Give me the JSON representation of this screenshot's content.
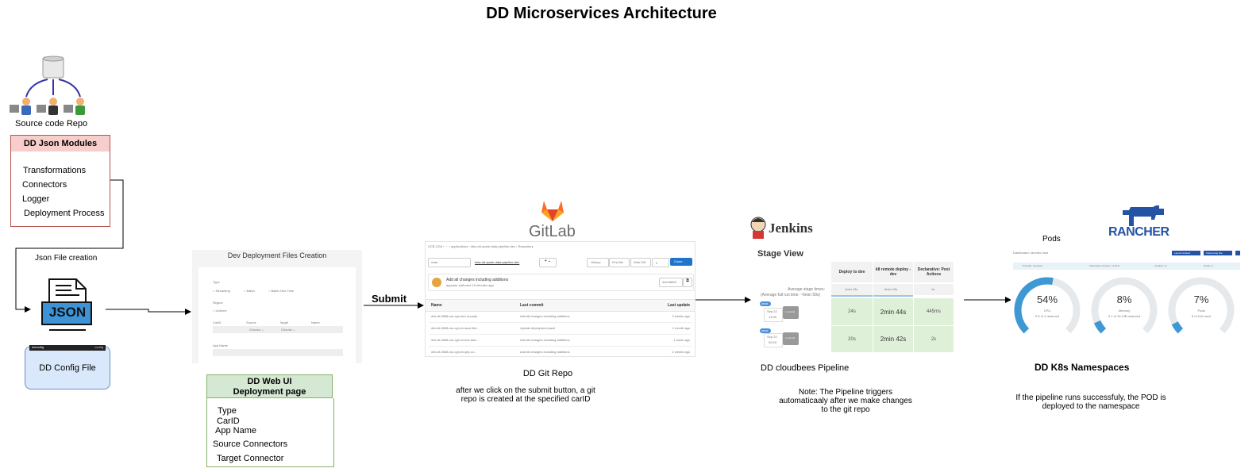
{
  "title": "DD Microservices Architecture",
  "source_repo": {
    "label": "Source code Repo",
    "icon_text": "Source Code Repository"
  },
  "json_modules": {
    "header": "DD Json Modules",
    "items": [
      "Transformations",
      "Connectors",
      "Logger",
      "Deployment Process"
    ]
  },
  "json_file_creation_label": "Json File creation",
  "json_icon_text": "JSON",
  "config_file": {
    "label": "DD Config File",
    "bar_left": "ddconfig",
    "bar_right": "config"
  },
  "dev_deploy_page": {
    "title": "Dev Deployment Files Creation",
    "type_label": "Type",
    "type_options": [
      "Streaming",
      "Batch",
      "Batch One Time"
    ],
    "region_label": "Region",
    "region_option": "Uniform",
    "columns": [
      "CarID",
      "Source",
      "Target",
      "Name"
    ],
    "choose_1": "Choose",
    "choose_2": "Choose",
    "app_name_label": "App Name"
  },
  "web_ui": {
    "header_line1": "DD Web UI",
    "header_line2": "Deployment page",
    "items": [
      "Type",
      "CarID",
      "App Name",
      "Source Connectors",
      "Target Connector"
    ]
  },
  "submit_label": "Submit",
  "gitlab": {
    "logo_text": "GitLab",
    "breadcrumb": "UCB-CDA  ›  ···  ›  applications  ›  ddw-dd-spark-data-pipeline-dev  ›  Repository",
    "branch": "main",
    "repo_path": "ddw-dd-spark-data-pipeline-dev",
    "buttons": [
      "History",
      "Find file",
      "Web IDE",
      "⤓",
      "Clone"
    ],
    "commit_title": "Add all changes including additions",
    "commit_meta": "appuser authored 15 minutes ago",
    "commit_hash": "34e18800",
    "table_headers": [
      "Name",
      "Last commit",
      "Last update"
    ],
    "rows": [
      {
        "name": "ddx-bt-0658-csv-rgh-dev-vt-party",
        "commit": "Add all changes including additions",
        "update": "3 weeks ago"
      },
      {
        "name": "ddx-bt-0658-csv-rgh-ed-acct-8xt...",
        "commit": "Update deployment.yaml",
        "update": "1 month ago"
      },
      {
        "name": "ddx-bt-0658-csv-rgh-ed-ent-add...",
        "commit": "Add all changes including additions",
        "update": "1 week ago"
      },
      {
        "name": "ddx-bt-0658-csv-rgh-ed-pty-co...",
        "commit": "Add all changes including additions",
        "update": "2 weeks ago"
      }
    ],
    "caption": "DD Git Repo",
    "note_line1": "after we click on the submit button, a git",
    "note_line2": "repo is created at the specified carID"
  },
  "jenkins": {
    "logo_text": "Jenkins",
    "stage_view": "Stage View",
    "stages": [
      "Deploy to dev",
      "k8 remote deploy - dev",
      "Declarative: Post Actions"
    ],
    "avg_label1": "Average stage times:",
    "avg_label2": "(Average full run time: ~6min 59s)",
    "avg_times": [
      "1min 13s",
      "5min 15s",
      "1s"
    ],
    "runs": [
      {
        "badge": "#####",
        "date": "Sep 22",
        "time": "13:39",
        "commit": "1 commit",
        "times": [
          "24s",
          "2min 44s",
          "445ms"
        ]
      },
      {
        "badge": "#####",
        "date": "Sep 22",
        "time": "09:20",
        "commit": "1 commit",
        "times": [
          "20s",
          "2min 42s",
          "2s"
        ]
      }
    ],
    "caption": "DD cloudbees Pipeline",
    "note_line1": "Note: The Pipeline triggers",
    "note_line2": "automaticaaly after we make changes",
    "note_line3": "to the git repo"
  },
  "rancher": {
    "logo_text": "RANCHER",
    "pods_label": "Pods",
    "dashboard_label": "Dashboard: rancher-host",
    "top_buttons": [
      "Launch kubectl",
      "Kubeconfig File"
    ],
    "tabs": [
      "Provider: Imported",
      "Kubernetes Version: v1.20.8",
      "Created: 1y",
      "Nodes: 4"
    ],
    "gauges": [
      {
        "name": "CPU",
        "value": "54%",
        "sub": "0.5 of 1 reserved",
        "fraction": 0.54
      },
      {
        "name": "Memory",
        "value": "8%",
        "sub": "0.1 of 16 GiB reserved",
        "fraction": 0.08
      },
      {
        "name": "Pods",
        "value": "7%",
        "sub": "8 of 110 used",
        "fraction": 0.07
      }
    ],
    "caption": "DD K8s Namespaces",
    "note_line1": "If the pipeline runs successfuly, the POD is",
    "note_line2": "deployed to the namespace"
  },
  "colors": {
    "json_module_fill": "#f8cecc",
    "json_module_stroke": "#b85450",
    "config_fill": "#dae8fc",
    "config_stroke": "#6c8ebf",
    "web_ui_fill": "#d5e8d4",
    "web_ui_stroke": "#82b366",
    "gitlab_orange": "#e24329",
    "rancher_blue": "#0075a8",
    "gauge_blue": "#3d98d3"
  }
}
